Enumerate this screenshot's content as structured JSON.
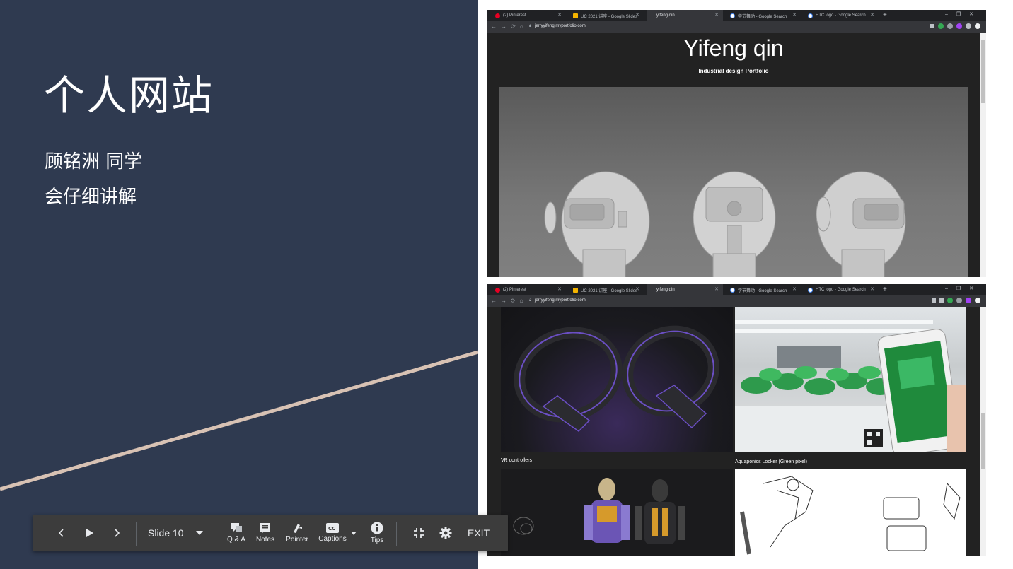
{
  "slide": {
    "title": "个人网站",
    "lines": [
      "顾铭洲 同学",
      "会仔细讲解"
    ]
  },
  "colors": {
    "slide_bg": "#2f3a50",
    "accent_line": "#d8c2b4",
    "toolbar_bg": "#3c3c3c"
  },
  "browser_top": {
    "tabs": [
      {
        "label": "(2) Pinterest",
        "icon": "pinterest-icon"
      },
      {
        "label": "UC 2021 讲座 - Google Slides",
        "icon": "slides-icon"
      },
      {
        "label": "yifeng qin",
        "icon": "none"
      },
      {
        "label": "学节舞动 - Google Search",
        "icon": "google-icon"
      },
      {
        "label": "HTC logo - Google Search",
        "icon": "google-icon"
      }
    ],
    "url": "jerryyifeng.myportfolio.com",
    "page_title": "Yifeng qin",
    "page_subtitle": "Industrial design Portfolio"
  },
  "browser_bottom": {
    "tabs": [
      {
        "label": "(2) Pinterest",
        "icon": "pinterest-icon"
      },
      {
        "label": "UC 2021 讲座 - Google Slides",
        "icon": "slides-icon"
      },
      {
        "label": "yifeng qin",
        "icon": "none"
      },
      {
        "label": "学节舞动 - Google Search",
        "icon": "google-icon"
      },
      {
        "label": "HTC logo - Google Search",
        "icon": "google-icon"
      }
    ],
    "url": "jerryyifeng.myportfolio.com",
    "projects": [
      {
        "caption": "VR controllers"
      },
      {
        "caption": "Aquaponics Locker (Green pixel)"
      }
    ]
  },
  "toolbar": {
    "slide_label": "Slide 10",
    "qa_label": "Q & A",
    "notes_label": "Notes",
    "pointer_label": "Pointer",
    "captions_label": "Captions",
    "tips_label": "Tips",
    "exit_label": "EXIT"
  }
}
